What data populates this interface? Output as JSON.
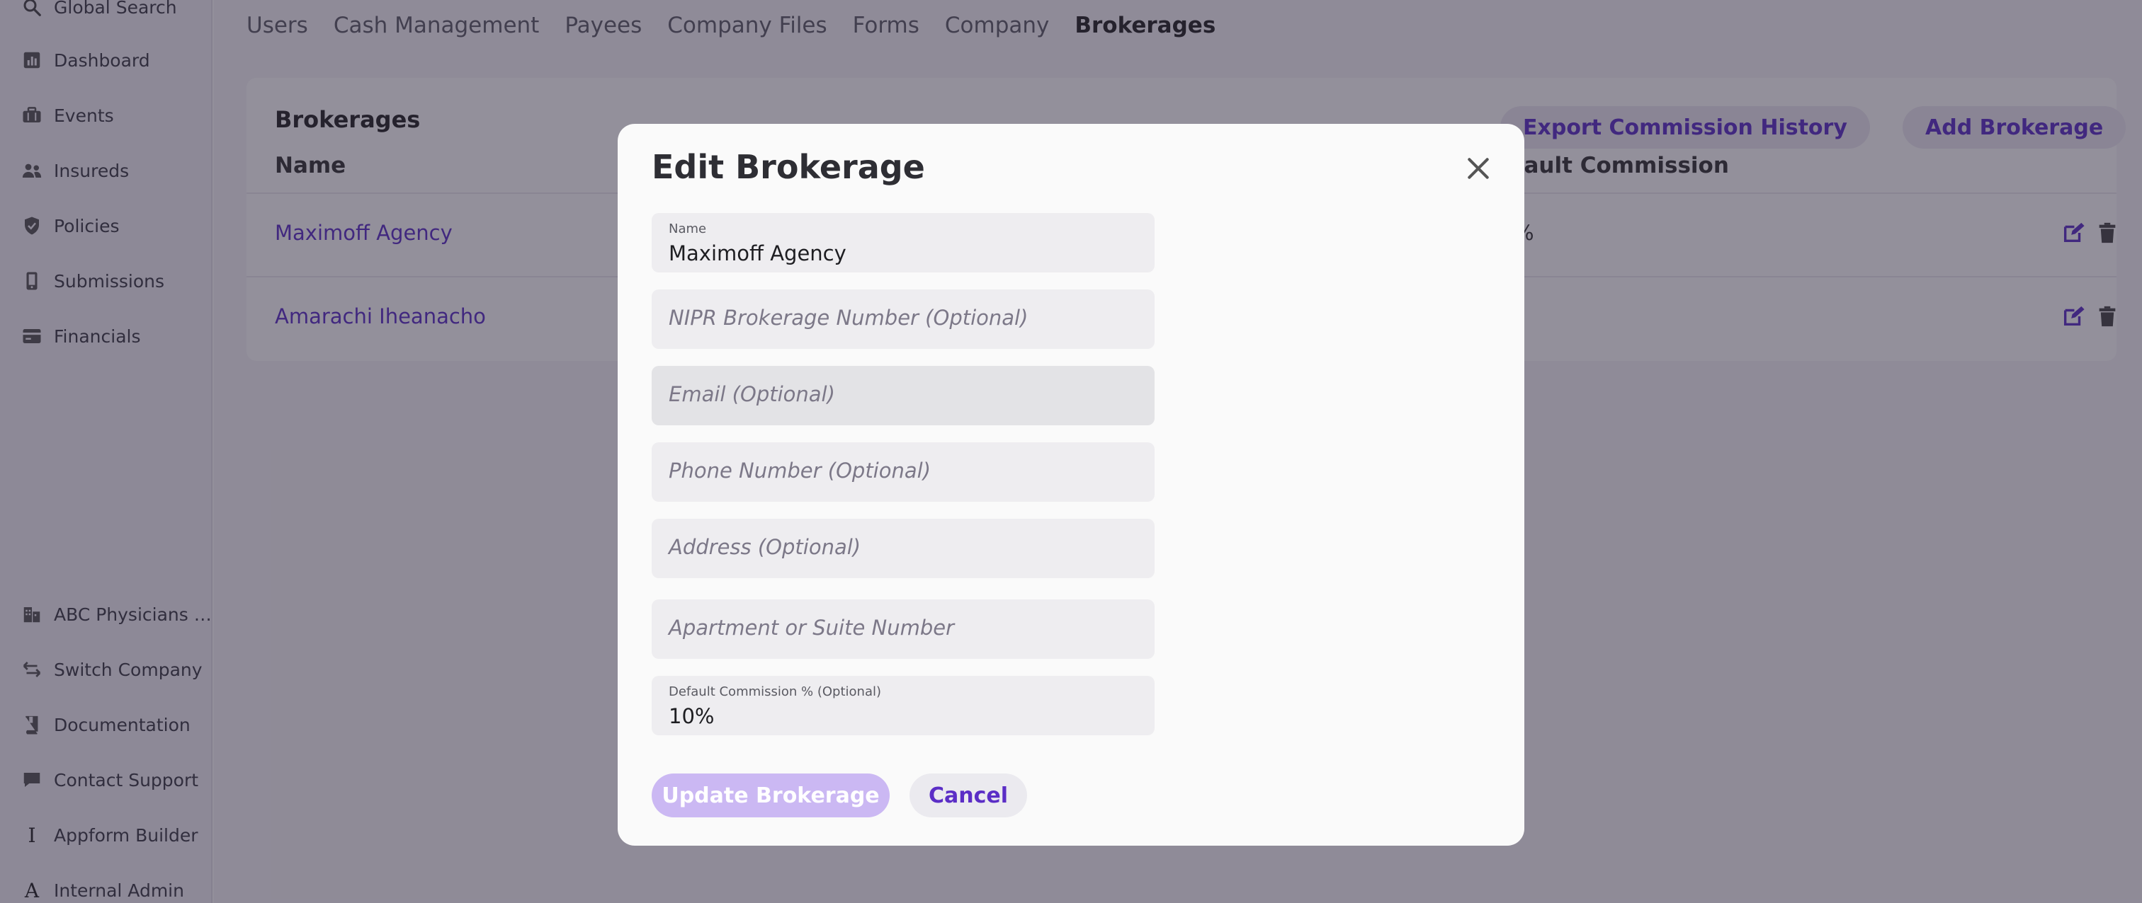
{
  "sidebar": {
    "top_items": [
      {
        "label": "Global Search",
        "icon": "search-icon"
      },
      {
        "label": "Dashboard",
        "icon": "dashboard-icon"
      },
      {
        "label": "Events",
        "icon": "briefcase-icon"
      },
      {
        "label": "Insureds",
        "icon": "people-icon"
      },
      {
        "label": "Policies",
        "icon": "shield-icon"
      },
      {
        "label": "Submissions",
        "icon": "phone-icon"
      },
      {
        "label": "Financials",
        "icon": "wallet-icon"
      }
    ],
    "bottom_items": [
      {
        "label": "ABC Physicians …",
        "icon": "building-icon"
      },
      {
        "label": "Switch Company",
        "icon": "switch-arrows-icon"
      },
      {
        "label": "Documentation",
        "icon": "book-icon"
      },
      {
        "label": "Contact Support",
        "icon": "chat-icon"
      },
      {
        "label": "Appform Builder",
        "icon": "letter-i-icon",
        "glyph": "I"
      },
      {
        "label": "Internal Admin",
        "icon": "letter-a-icon",
        "glyph": "A"
      }
    ]
  },
  "tabs": [
    "Users",
    "Cash Management",
    "Payees",
    "Company Files",
    "Forms",
    "Company",
    "Brokerages"
  ],
  "active_tab": "Brokerages",
  "card": {
    "title": "Brokerages",
    "col_name": "Name",
    "col_commission": "fault Commission",
    "export_label": "Export Commission History",
    "add_label": "Add Brokerage",
    "rows": [
      {
        "name": "Maximoff Agency",
        "commission": "%"
      },
      {
        "name": "Amarachi Iheanacho",
        "commission": ""
      }
    ]
  },
  "modal": {
    "title": "Edit Brokerage",
    "name_label": "Name",
    "name_value": "Maximoff Agency",
    "nipr_placeholder": "NIPR Brokerage Number (Optional)",
    "email_placeholder": "Email (Optional)",
    "phone_placeholder": "Phone Number (Optional)",
    "address_placeholder": "Address (Optional)",
    "apt_placeholder": "Apartment or Suite Number",
    "commission_label": "Default Commission % (Optional)",
    "commission_value": "10%",
    "update_label": "Update Brokerage",
    "cancel_label": "Cancel"
  },
  "colors": {
    "accent": "#5b2ec6",
    "primary_disabled": "#cbb8f3",
    "overlay": "rgba(40,34,55,0.5)"
  }
}
